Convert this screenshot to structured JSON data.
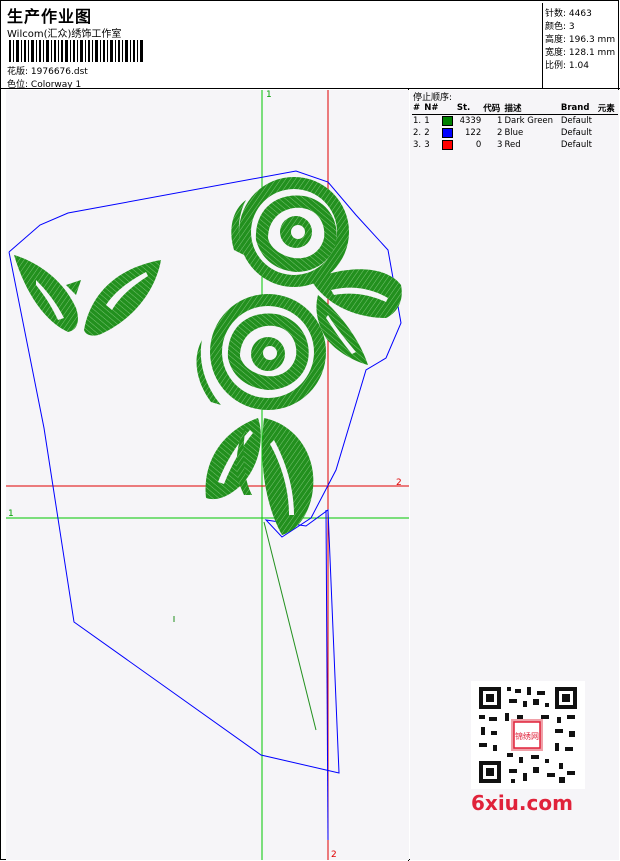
{
  "header": {
    "title": "生产作业图",
    "studio": "Wilcom(汇众)绣饰工作室",
    "design_label": "花版:",
    "design_value": "1976676.dst",
    "colorway_label": "色位:",
    "colorway_value": "Colorway 1"
  },
  "stats": {
    "stitches_label": "针数:",
    "stitches_value": "4463",
    "colors_label": "颜色:",
    "colors_value": "3",
    "height_label": "高度:",
    "height_value": "196.3 mm",
    "width_label": "宽度:",
    "width_value": "128.1 mm",
    "scale_label": "比例:",
    "scale_value": "1.04"
  },
  "stop_sequence": {
    "title": "停止顺序:",
    "columns": [
      "#",
      "N#",
      "St.",
      "代码",
      "描述",
      "Brand",
      "元素"
    ],
    "rows": [
      {
        "idx": "1.",
        "n": "1",
        "color": "#008000",
        "st": "4339",
        "code": "1",
        "desc": "Dark Green",
        "brand": "Default"
      },
      {
        "idx": "2.",
        "n": "2",
        "color": "#0000ff",
        "st": "122",
        "code": "2",
        "desc": "Blue",
        "brand": "Default"
      },
      {
        "idx": "3.",
        "n": "3",
        "color": "#ff0000",
        "st": "0",
        "code": "3",
        "desc": "Red",
        "brand": "Default"
      }
    ]
  },
  "guides": {
    "green_vertical_label": "1",
    "green_horizontal_label": "1",
    "red_horizontal_label": "2",
    "red_vertical_label": "2"
  },
  "watermark": {
    "qr_caption": "锦绣网",
    "logo_text": "6xiu.com"
  },
  "colors": {
    "embroidery": "#22901e",
    "outline": "#0000ff",
    "guide_green": "#00c800",
    "guide_red": "#e00000",
    "logo": "#e0223a"
  }
}
